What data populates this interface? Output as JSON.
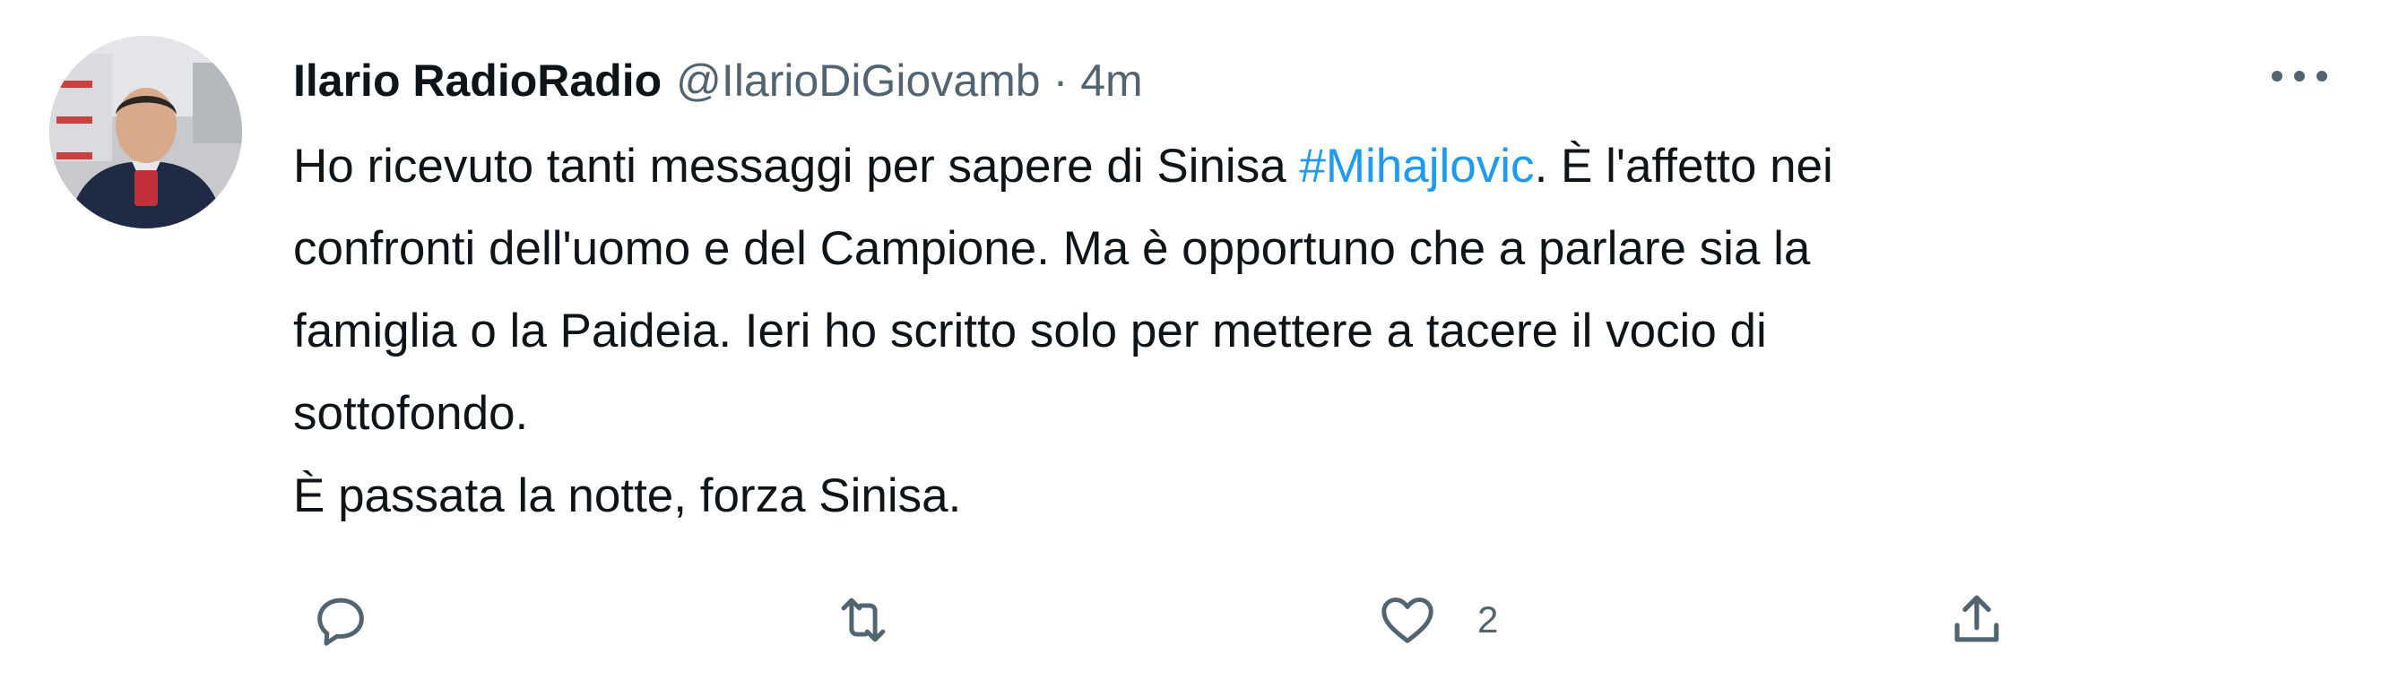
{
  "tweet": {
    "author_name": "Ilario RadioRadio",
    "handle": "@IlarioDiGiovamb",
    "separator": "·",
    "time": "4m",
    "text_lines": [
      {
        "before": "Ho ricevuto tanti messaggi per sapere di Sinisa ",
        "hashtag": "#Mihajlovic",
        "after": ". È l'affetto nei"
      },
      {
        "text": "confronti dell'uomo e del Campione. Ma è opportuno che a parlare sia la"
      },
      {
        "text": "famiglia o la Paideia. Ieri ho scritto solo per mettere a tacere il vocio di"
      },
      {
        "text": "sottofondo."
      },
      {
        "text": "È passata la notte, forza Sinisa."
      }
    ],
    "actions": {
      "reply_icon": "reply-icon",
      "retweet_icon": "retweet-icon",
      "like_icon": "heart-icon",
      "like_count": "2",
      "share_icon": "share-icon"
    },
    "more_icon": "more-dots-icon"
  },
  "colors": {
    "text": "#0f1419",
    "secondary": "#536471",
    "hashtag": "#1d9bf0"
  }
}
